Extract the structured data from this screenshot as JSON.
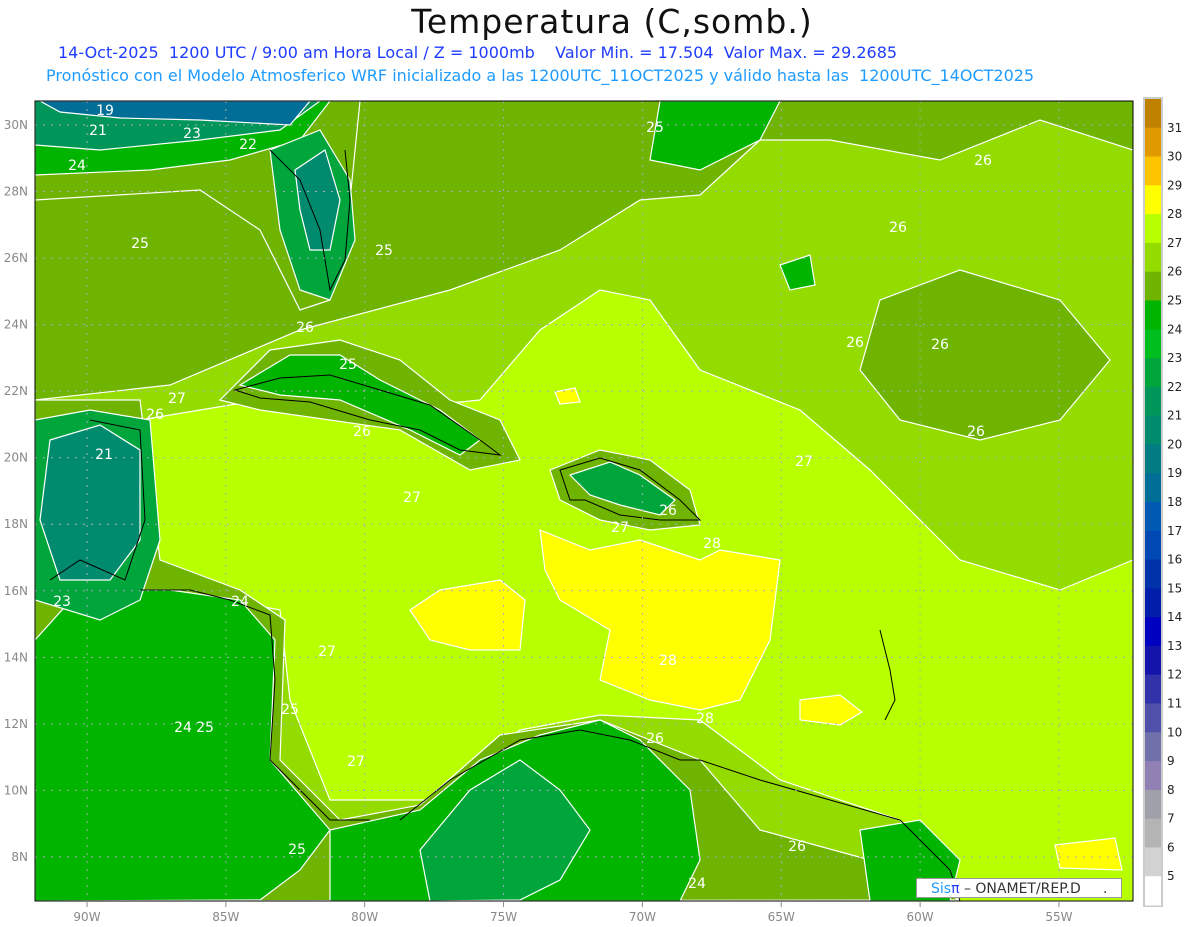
{
  "header": {
    "title": "Temperatura (C,somb.)",
    "line1": "14-Oct-2025  1200 UTC / 9:00 am Hora Local / Z = 1000mb    Valor Min. = 17.504  Valor Max. = 29.2685",
    "line2": "Pronóstico con el Modelo Atmosferico WRF inicializado a las 1200UTC_11OCT2025 y válido hasta las  1200UTC_14OCT2025"
  },
  "map": {
    "variable": "Temperatura",
    "units": "C",
    "level": "1000mb",
    "valid": "14-Oct-2025 1200 UTC",
    "value_min": 17.504,
    "value_max": 29.2685,
    "lon_labels": [
      "90W",
      "85W",
      "80W",
      "75W",
      "70W",
      "65W",
      "60W",
      "55W"
    ],
    "lat_labels": [
      "30N",
      "28N",
      "26N",
      "24N",
      "22N",
      "20N",
      "18N",
      "16N",
      "14N",
      "12N",
      "10N",
      "8N"
    ],
    "contour_labels": [
      "19",
      "21",
      "23",
      "22",
      "24",
      "25",
      "26",
      "25",
      "25",
      "26",
      "26",
      "26",
      "26",
      "25",
      "27",
      "26",
      "26",
      "26",
      "21",
      "27",
      "27",
      "26",
      "27",
      "28",
      "23",
      "24",
      "27",
      "28",
      "25",
      "24",
      "25",
      "28",
      "26",
      "27",
      "25",
      "26",
      "24"
    ]
  },
  "colorbar": {
    "labels": [
      "31",
      "30",
      "29",
      "28",
      "27",
      "26",
      "25",
      "24",
      "23",
      "22",
      "21",
      "20",
      "19",
      "18",
      "17",
      "16",
      "15",
      "14",
      "13",
      "12",
      "11",
      "10",
      "9",
      "8",
      "7",
      "6",
      "5"
    ],
    "colors": [
      "#c08000",
      "#e09a00",
      "#ffc400",
      "#ffff00",
      "#b8ff00",
      "#94dc00",
      "#6eb400",
      "#00b400",
      "#00be1e",
      "#00a53c",
      "#00965a",
      "#008a6e",
      "#007c82",
      "#006e96",
      "#005ab4",
      "#0048b4",
      "#0032aa",
      "#001eaa",
      "#0000c0",
      "#1414aa",
      "#3232aa",
      "#5050aa",
      "#7070aa",
      "#9080b4",
      "#a0a0aa",
      "#b4b4b4",
      "#d2d2d2",
      "#ffffff"
    ]
  },
  "footer": {
    "logo_sis": "Sis",
    "logo_pi": "π",
    "credit": " – ONAMET/REP.D     ."
  }
}
